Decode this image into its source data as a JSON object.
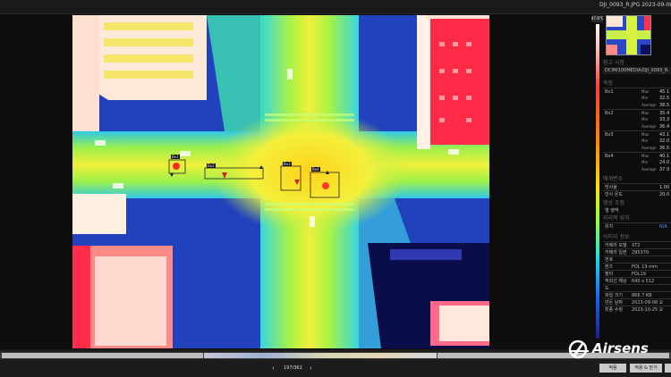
{
  "titlebar": {
    "filename": "DJI_0093_R.JPG    2023-09-08"
  },
  "scale": {
    "max_label": "47.6°C"
  },
  "roi": {
    "labels": [
      "Bx1",
      "Bx2",
      "Bx3",
      "Bx4"
    ]
  },
  "panel": {
    "ref_title": "참고 사항",
    "path": "DCIM/100MEDIA/DJI_0093_R.",
    "measure_title": "측정",
    "boxes": [
      {
        "name": "Bx1",
        "rows": [
          [
            "Max",
            "45.1"
          ],
          [
            "Min",
            "32.5"
          ],
          [
            "Average",
            "38.5"
          ]
        ]
      },
      {
        "name": "Bx2",
        "rows": [
          [
            "Max",
            "35.4"
          ],
          [
            "Min",
            "33.3"
          ],
          [
            "Average",
            "36.4"
          ]
        ]
      },
      {
        "name": "Bx3",
        "rows": [
          [
            "Max",
            "43.1"
          ],
          [
            "Min",
            "32.0"
          ],
          [
            "Average",
            "36.5"
          ]
        ]
      },
      {
        "name": "Bx4",
        "rows": [
          [
            "Max",
            "40.1"
          ],
          [
            "Min",
            "24.0"
          ],
          [
            "Average",
            "37.9"
          ]
        ]
      }
    ],
    "env_title": "매개변수",
    "emissivity_label": "방사율",
    "emissivity_value": "1.00",
    "reflected_label": "반사 온도",
    "reflected_value": "20.0",
    "image_title": "영상 조정",
    "image_sub": "열 영역",
    "location_title": "지리적 위치",
    "location_label": "위치",
    "location_value": "N/A",
    "info_title": "이미지 정보",
    "info": [
      [
        "카메라 모델",
        "XT2"
      ],
      [
        "카메라 일련",
        "295370"
      ],
      [
        "번호",
        ""
      ],
      [
        "렌즈",
        "FOL 19 mm"
      ],
      [
        "필터",
        "FOL19"
      ],
      [
        "적외선 해상",
        "640 x 512"
      ],
      [
        "도",
        ""
      ],
      [
        "파일 크기",
        "866.7 KB"
      ],
      [
        "만든 날짜",
        "2023-09-08 오"
      ],
      [
        "최종 수정",
        "2023-10-25 오"
      ]
    ]
  },
  "bottom": {
    "prev": "‹",
    "page": "197/362",
    "next": "›",
    "btn1": "적용",
    "btn2": "적용 & 닫기",
    "btn3": ""
  },
  "logo": {
    "text": "Airsens"
  }
}
